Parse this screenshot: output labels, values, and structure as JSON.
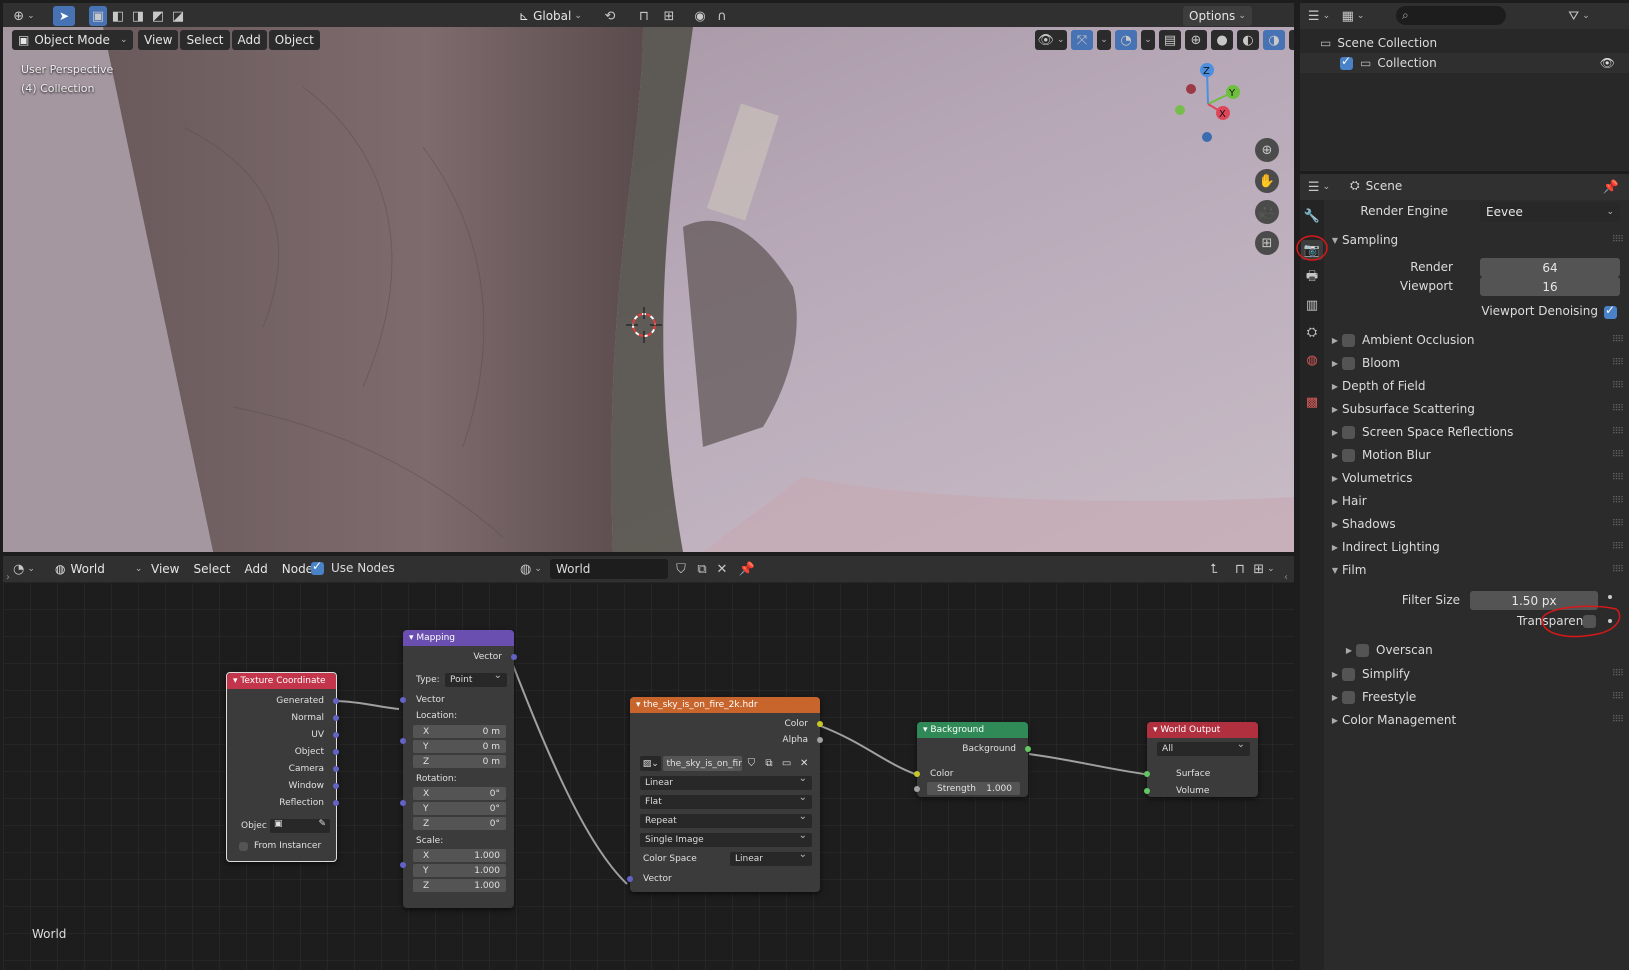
{
  "viewport": {
    "mode": "Object Mode",
    "menu": [
      "View",
      "Select",
      "Add",
      "Object"
    ],
    "orientation": "Global",
    "options_label": "Options",
    "overlay_text": [
      "User Perspective",
      "(4) Collection"
    ],
    "gizmo": {
      "z": "Z",
      "y": "Y",
      "x": "X"
    }
  },
  "outliner": {
    "scene_collection": "Scene Collection",
    "collection": "Collection"
  },
  "properties": {
    "context": "Scene",
    "render_engine_label": "Render Engine",
    "render_engine": "Eevee",
    "sampling": {
      "label": "Sampling",
      "render_label": "Render",
      "render": "64",
      "viewport_label": "Viewport",
      "viewport": "16",
      "denoise_label": "Viewport Denoising"
    },
    "panels": [
      "Ambient Occlusion",
      "Bloom",
      "Depth of Field",
      "Subsurface Scattering",
      "Screen Space Reflections",
      "Motion Blur",
      "Volumetrics",
      "Hair",
      "Shadows",
      "Indirect Lighting"
    ],
    "film": {
      "label": "Film",
      "filter_size_label": "Filter Size",
      "filter_size": "1.50 px",
      "transparent_label": "Transparent",
      "overscan_label": "Overscan"
    },
    "bottom_panels": [
      "Simplify",
      "Freestyle",
      "Color Management"
    ]
  },
  "node_editor": {
    "type": "World",
    "menu": [
      "View",
      "Select",
      "Add",
      "Node"
    ],
    "use_nodes_label": "Use Nodes",
    "world_name": "World",
    "corner_label": "World"
  },
  "nodes": {
    "texcoord": {
      "title": "Texture Coordinate",
      "outputs": [
        "Generated",
        "Normal",
        "UV",
        "Object",
        "Camera",
        "Window",
        "Reflection"
      ],
      "object_label": "Objec",
      "from_instancer": "From Instancer"
    },
    "mapping": {
      "title": "Mapping",
      "out_vector": "Vector",
      "type_label": "Type:",
      "type_value": "Point",
      "in_vector": "Vector",
      "location_label": "Location:",
      "location": [
        "0 m",
        "0 m",
        "0 m"
      ],
      "rotation_label": "Rotation:",
      "rotation": [
        "0°",
        "0°",
        "0°"
      ],
      "scale_label": "Scale:",
      "scale": [
        "1.000",
        "1.000",
        "1.000"
      ],
      "axes": [
        "X",
        "Y",
        "Z"
      ]
    },
    "image": {
      "title": "the_sky_is_on_fire_2k.hdr",
      "out_color": "Color",
      "out_alpha": "Alpha",
      "image_name": "the_sky_is_on_fire...",
      "interpolation": "Linear",
      "projection": "Flat",
      "extension": "Repeat",
      "source": "Single Image",
      "color_space_label": "Color Space",
      "color_space": "Linear",
      "in_vector": "Vector"
    },
    "background": {
      "title": "Background",
      "out": "Background",
      "in_color": "Color",
      "strength_label": "Strength",
      "strength": "1.000"
    },
    "output": {
      "title": "World Output",
      "target": "All",
      "surface": "Surface",
      "volume": "Volume"
    }
  }
}
